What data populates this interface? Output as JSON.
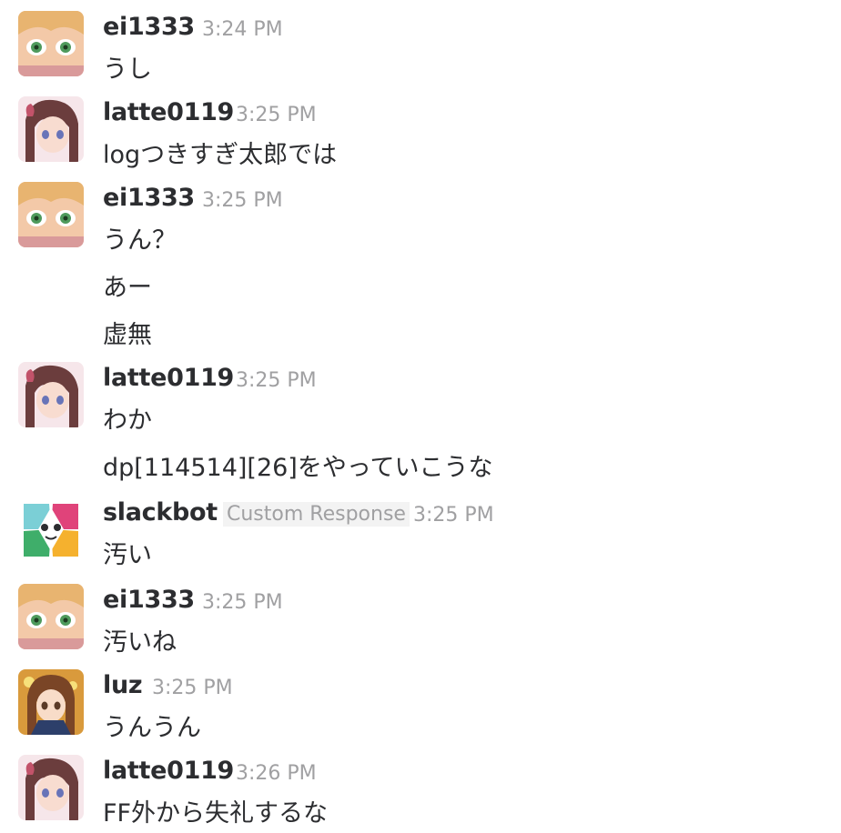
{
  "messages": [
    {
      "user": "ei1333",
      "time": "3:24 PM",
      "lines": [
        "うし"
      ]
    },
    {
      "user": "latte0119",
      "time": "3:25 PM",
      "lines": [
        "logつきすぎ太郎では"
      ]
    },
    {
      "user": "ei1333",
      "time": "3:25 PM",
      "lines": [
        "うん？",
        "あー",
        "虚無"
      ]
    },
    {
      "user": "latte0119",
      "time": "3:25 PM",
      "lines": [
        "わか",
        "dp[114514][26]をやっていこうな"
      ]
    },
    {
      "user": "slackbot",
      "tag": "Custom Response",
      "time": "3:25 PM",
      "lines": [
        "汚い"
      ]
    },
    {
      "user": "ei1333",
      "time": "3:25 PM",
      "lines": [
        "汚いね"
      ]
    },
    {
      "user": "luz",
      "time": "3:25 PM",
      "lines": [
        "うんうん"
      ]
    },
    {
      "user": "latte0119",
      "time": "3:26 PM",
      "lines": [
        "FF外から失礼するな"
      ]
    }
  ],
  "colors": {
    "username": "#2c2d30",
    "timestamp": "#a0a0a2",
    "text": "#2c2d30",
    "tag_bg": "#f3f3f3"
  }
}
